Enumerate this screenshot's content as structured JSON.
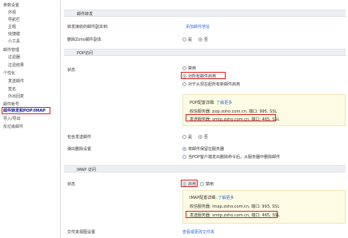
{
  "sidebar": {
    "items": [
      {
        "label": "参数设置",
        "level": 0
      },
      {
        "label": "外观",
        "level": 1
      },
      {
        "label": "导航栏",
        "level": 1
      },
      {
        "label": "主题",
        "level": 1
      },
      {
        "label": "快捷键",
        "level": 1
      },
      {
        "label": "小工具",
        "level": 1
      },
      {
        "label": "邮件管理",
        "level": 0
      },
      {
        "label": "过滤器",
        "level": 1
      },
      {
        "label": "过滤结果",
        "level": 1
      },
      {
        "label": "个性化",
        "level": 0
      },
      {
        "label": "发送邮件",
        "level": 1
      },
      {
        "label": "签名",
        "level": 1
      },
      {
        "label": "外出回复",
        "level": 1
      },
      {
        "label": "邮件帐号",
        "level": 0
      },
      {
        "label": "邮件转发和POP/IMAP",
        "level": 0,
        "active": true
      },
      {
        "label": "导入/导出",
        "level": 0
      },
      {
        "label": "反垃圾邮件",
        "level": 0
      }
    ]
  },
  "forwarding": {
    "section_title": "邮件转发",
    "forward_label": "转发接收的邮件副本到:",
    "add_forward_link": "添加邮件地址",
    "delete_label": "删除Zoho邮件副本",
    "yes": "是",
    "no": "否"
  },
  "pop": {
    "section_title": "POP访问",
    "status_label": "状态",
    "opt_disable": "禁用",
    "opt_all": "对所有邮件启用",
    "opt_new": "对于从现在起所有新邮件启用",
    "info_title": "POP配置详细:",
    "info_more": "了解更多",
    "incoming": "收信服务器: pop.zoho.com.cn, 端口: 995, SSL",
    "outgoing": "发送服务器: smtp.zoho.com.cn, 端口: 465, SSL",
    "include_sent_label": "包含发送邮件",
    "yes": "是",
    "no": "否",
    "popup_label": "弹出删除设置",
    "popup_opt_keep": "将邮件保留在服务器",
    "popup_opt_delete": "当POP客户端发出删除命令后，从服务器中删除邮件"
  },
  "imap": {
    "section_title": "IMAP 访问",
    "status_label": "状态",
    "opt_enable": "启用",
    "opt_disable": "禁用",
    "info_title": "IMAP配置详细:",
    "info_more": "了解更多",
    "incoming": "收信服务器: imap.zoho.com.cn, 端口: 993, SSL",
    "outgoing": "发送服务器: smtp.zoho.com.cn, 端口: 465, SSL",
    "folder_label": "文件夹视图设置",
    "folder_link": "查看或更改文件夹"
  }
}
